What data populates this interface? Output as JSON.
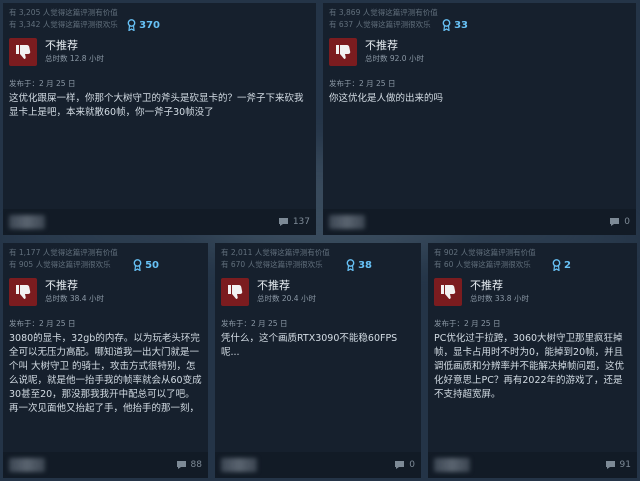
{
  "colors": {
    "accent": "#67c1f5",
    "thumb_bg": "#7b1c1f",
    "card_bg": "#16202d",
    "page_bg": "#243447"
  },
  "cards": [
    {
      "helpful": "有 3,205 人觉得这篇评测有价值",
      "funny": "有 3,342 人觉得这篇评测很欢乐",
      "awards": "370",
      "recommendation": "不推荐",
      "hours": "总时数 12.8 小时",
      "posted": "发布于：2 月 25 日",
      "text": "这优化跟屎一样，你那个大树守卫的斧头是砍显卡的？一斧子下来砍我显卡上是吧，本来就散60帧，你一斧子30帧没了",
      "comments": "137"
    },
    {
      "helpful": "有 3,869 人觉得这篇评测有价值",
      "funny": "有 637 人觉得这篇评测很欢乐",
      "awards": "33",
      "recommendation": "不推荐",
      "hours": "总时数 92.0 小时",
      "posted": "发布于：2 月 25 日",
      "text": "你这优化是人做的出来的吗",
      "comments": "0"
    },
    {
      "helpful": "有 1,177 人觉得这篇评测有价值",
      "funny": "有 905 人觉得这篇评测很欢乐",
      "awards": "50",
      "recommendation": "不推荐",
      "hours": "总时数 38.4 小时",
      "posted": "发布于：2 月 25 日",
      "text": "3080的显卡，32gb的内存。以为玩老头环完全可以无压力高配。哪知道我一出大门就是一个叫 大树守卫 的骑士，攻击方式很特别，怎么说呢，就是他一抬手我的帧率就会从60变成30甚至20，那没那我我开中配总可以了吧。再一次见面他又抬起了手，他抬手的那一刻，",
      "comments": "88"
    },
    {
      "helpful": "有 2,011 人觉得这篇评测有价值",
      "funny": "有 670 人觉得这篇评测很欢乐",
      "awards": "38",
      "recommendation": "不推荐",
      "hours": "总时数 20.4 小时",
      "posted": "发布于：2 月 25 日",
      "text": "凭什么，这个画质RTX3090不能稳60FPS呢...",
      "comments": "0"
    },
    {
      "helpful": "有 902 人觉得这篇评测有价值",
      "funny": "有 60 人觉得这篇评测很欢乐",
      "awards": "2",
      "recommendation": "不推荐",
      "hours": "总时数 33.8 小时",
      "posted": "发布于：2 月 25 日",
      "text": "PC优化过于拉跨，3060大树守卫那里疯狂掉帧，显卡占用时不时为0，能掉到20帧，并且调低画质和分辨率并不能解决掉帧问题，这优化好意思上PC？再有2022年的游戏了，还是不支持超宽屏。",
      "comments": "91"
    }
  ]
}
